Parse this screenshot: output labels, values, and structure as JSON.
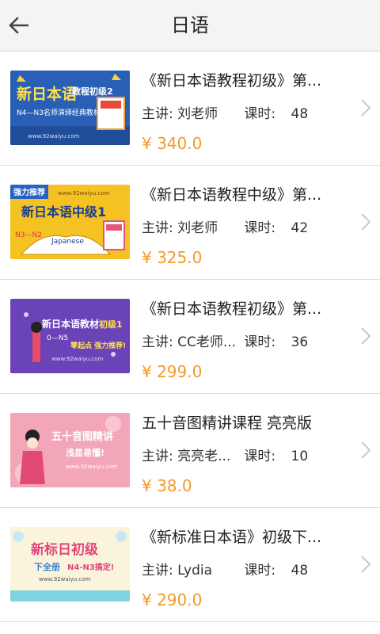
{
  "header": {
    "title": "日语"
  },
  "courses": [
    {
      "name": "《新日本语教程初级》第...",
      "teacher_label": "主讲: 刘老师",
      "hours_label": "课时:",
      "hours": "48",
      "price": "¥ 340.0",
      "thumb": {
        "line1": "新日本语",
        "line2": "教程初级2",
        "line3": "N4—N3名师演绎经典教材",
        "url": "www.92waiyu.com",
        "bg": "#2a5fb6"
      }
    },
    {
      "name": "《新日本语教程中级》第...",
      "teacher_label": "主讲: 刘老师",
      "hours_label": "课时:",
      "hours": "42",
      "price": "¥ 325.0",
      "thumb": {
        "line1": "强力推荐",
        "line2": "新日本语中级1",
        "line3": "N3—N2",
        "line4": "Japanese",
        "url": "www.92waiyu.com",
        "bg": "#f5c224"
      }
    },
    {
      "name": "《新日本语教程初级》第...",
      "teacher_label": "主讲: CC老师...",
      "hours_label": "课时:",
      "hours": "36",
      "price": "¥ 299.0",
      "thumb": {
        "line1": "新日本语教材",
        "line2": "初级1",
        "line3": "0—N5",
        "line4": "零起点 强力推荐!",
        "url": "www.92waiyu.com",
        "bg": "#6a43b8"
      }
    },
    {
      "name": "五十音图精讲课程 亮亮版",
      "teacher_label": "主讲: 亮亮老...",
      "hours_label": "课时:",
      "hours": "10",
      "price": "¥ 38.0",
      "thumb": {
        "line1": "五十音图精讲",
        "line2": "浅显易懂!",
        "url": "www.92waiyu.com",
        "bg": "#f3a6b8"
      }
    },
    {
      "name": "《新标准日本语》初级下...",
      "teacher_label": "主讲: Lydia",
      "hours_label": "课时:",
      "hours": "48",
      "price": "¥ 290.0",
      "thumb": {
        "line1": "新标日初级",
        "line2": "下全册",
        "line3": "N4-N3搞定!",
        "url": "www.92waiyu.com",
        "bg": "#fbf4dc"
      }
    }
  ]
}
